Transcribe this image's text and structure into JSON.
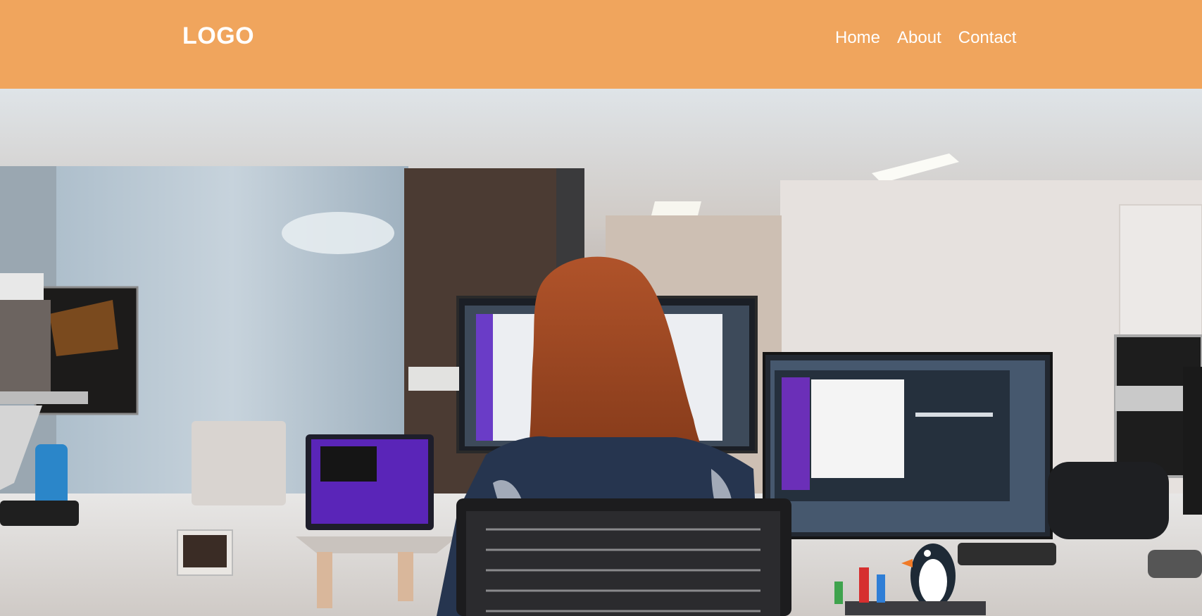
{
  "header": {
    "logo": "LOGO",
    "nav": [
      {
        "label": "Home"
      },
      {
        "label": "About"
      },
      {
        "label": "Contact"
      }
    ]
  },
  "colors": {
    "header_bg": "#f0a55d",
    "header_text": "#ffffff"
  },
  "hero": {
    "icon": "office-photo"
  }
}
